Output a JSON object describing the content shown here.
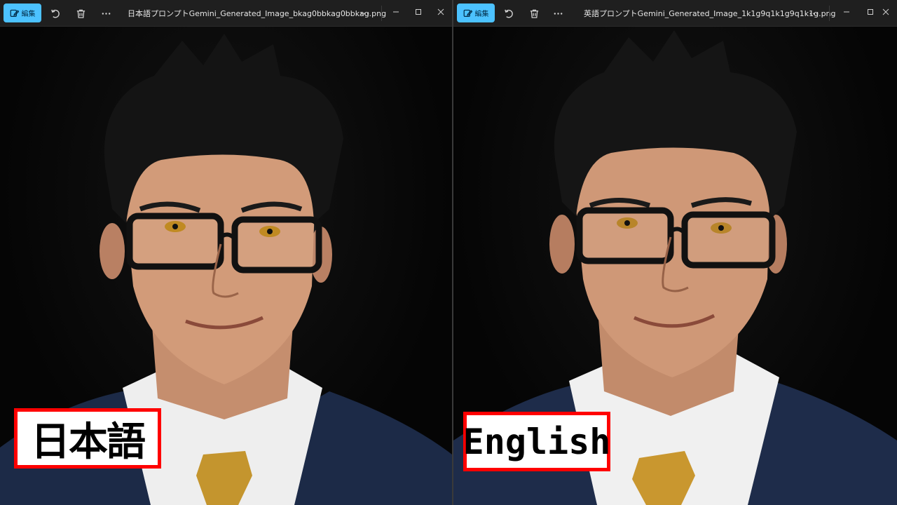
{
  "colors": {
    "accent": "#4cc2ff",
    "label_border": "#ff0000",
    "titlebar": "#1f1f1f"
  },
  "left_window": {
    "edit_label": "編集",
    "filename": "日本語プロンプトGemini_Generated_Image_bkag0bbkag0bbkag.png",
    "icons": [
      "edit-icon",
      "rotate-icon",
      "delete-icon",
      "more-icon",
      "minimize-icon",
      "maximize-icon",
      "close-icon"
    ]
  },
  "right_window": {
    "edit_label": "編集",
    "filename": "英語プロンプトGemini_Generated_Image_1k1g9q1k1g9q1k1g.png",
    "icons": [
      "edit-icon",
      "rotate-icon",
      "delete-icon",
      "more-icon",
      "minimize-icon",
      "maximize-icon",
      "close-icon"
    ]
  },
  "labels": {
    "left": "日本語",
    "right": "English"
  }
}
